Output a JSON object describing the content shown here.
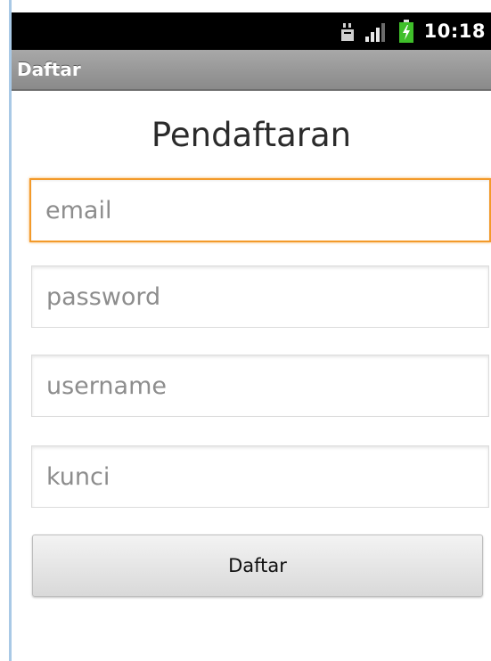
{
  "status_bar": {
    "time": "10:18",
    "icons": [
      "usb-debug-icon",
      "signal-icon",
      "battery-charging-icon"
    ]
  },
  "app_bar": {
    "title": "Daftar"
  },
  "form": {
    "heading": "Pendaftaran",
    "fields": [
      {
        "name": "email",
        "placeholder": "email",
        "value": ""
      },
      {
        "name": "password",
        "placeholder": "password",
        "value": ""
      },
      {
        "name": "username",
        "placeholder": "username",
        "value": ""
      },
      {
        "name": "kunci",
        "placeholder": "kunci",
        "value": ""
      }
    ],
    "focused_field": "email",
    "submit_label": "Daftar"
  },
  "colors": {
    "status_bar_bg": "#000000",
    "title_bar_bg": "#999999",
    "focus_accent": "#f39a2a",
    "battery_green": "#3fbf2a"
  }
}
